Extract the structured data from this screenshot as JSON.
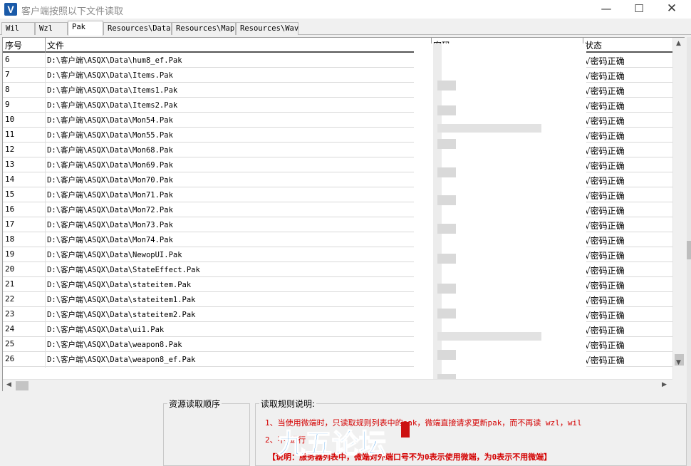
{
  "window": {
    "title": "客户端按照以下文件读取",
    "icon_letter": "V",
    "minimize_glyph": "—",
    "maximize_glyph": "☐",
    "close_glyph": "✕"
  },
  "tabs": [
    {
      "label": "Wil"
    },
    {
      "label": "Wzl"
    },
    {
      "label": "Pak",
      "active": true
    },
    {
      "label": "Resources\\Data"
    },
    {
      "label": "Resources\\Map"
    },
    {
      "label": "Resources\\Wav"
    }
  ],
  "table": {
    "columns": [
      "序号",
      "文件",
      "密码",
      "状态"
    ],
    "rows": [
      {
        "idx": "6",
        "file": "D:\\客户端\\ASQX\\Data\\hum8_ef.Pak",
        "status": "√密码正确"
      },
      {
        "idx": "7",
        "file": "D:\\客户端\\ASQX\\Data\\Items.Pak",
        "status": "√密码正确"
      },
      {
        "idx": "8",
        "file": "D:\\客户端\\ASQX\\Data\\Items1.Pak",
        "status": "√密码正确"
      },
      {
        "idx": "9",
        "file": "D:\\客户端\\ASQX\\Data\\Items2.Pak",
        "status": "√密码正确"
      },
      {
        "idx": "10",
        "file": "D:\\客户端\\ASQX\\Data\\Mon54.Pak",
        "status": "√密码正确"
      },
      {
        "idx": "11",
        "file": "D:\\客户端\\ASQX\\Data\\Mon55.Pak",
        "status": "√密码正确"
      },
      {
        "idx": "12",
        "file": "D:\\客户端\\ASQX\\Data\\Mon68.Pak",
        "status": "√密码正确"
      },
      {
        "idx": "13",
        "file": "D:\\客户端\\ASQX\\Data\\Mon69.Pak",
        "status": "√密码正确"
      },
      {
        "idx": "14",
        "file": "D:\\客户端\\ASQX\\Data\\Mon70.Pak",
        "status": "√密码正确"
      },
      {
        "idx": "15",
        "file": "D:\\客户端\\ASQX\\Data\\Mon71.Pak",
        "status": "√密码正确"
      },
      {
        "idx": "16",
        "file": "D:\\客户端\\ASQX\\Data\\Mon72.Pak",
        "status": "√密码正确"
      },
      {
        "idx": "17",
        "file": "D:\\客户端\\ASQX\\Data\\Mon73.Pak",
        "status": "√密码正确"
      },
      {
        "idx": "18",
        "file": "D:\\客户端\\ASQX\\Data\\Mon74.Pak",
        "status": "√密码正确"
      },
      {
        "idx": "19",
        "file": "D:\\客户端\\ASQX\\Data\\NewopUI.Pak",
        "status": "√密码正确"
      },
      {
        "idx": "20",
        "file": "D:\\客户端\\ASQX\\Data\\StateEffect.Pak",
        "status": "√密码正确"
      },
      {
        "idx": "21",
        "file": "D:\\客户端\\ASQX\\Data\\stateitem.Pak",
        "status": "√密码正确"
      },
      {
        "idx": "22",
        "file": "D:\\客户端\\ASQX\\Data\\stateitem1.Pak",
        "status": "√密码正确"
      },
      {
        "idx": "23",
        "file": "D:\\客户端\\ASQX\\Data\\stateitem2.Pak",
        "status": "√密码正确"
      },
      {
        "idx": "24",
        "file": "D:\\客户端\\ASQX\\Data\\ui1.Pak",
        "status": "√密码正确"
      },
      {
        "idx": "25",
        "file": "D:\\客户端\\ASQX\\Data\\weapon8.Pak",
        "status": "√密码正确"
      },
      {
        "idx": "26",
        "file": "D:\\客户端\\ASQX\\Data\\weapon8_ef.Pak",
        "status": "√密码正确"
      }
    ]
  },
  "bottom": {
    "load_order_label": "资源读取顺序",
    "rules_label": "读取规则说明:",
    "rule1": "1、当使用微端时，只读取规则列表中的pak，微端直接请求更新pak，而不再读 wzl，wil",
    "rule2": "2、不                                              进行",
    "note": "【说明：服务器列表中，微端对外端口号不为0表示使用微端，为0表示不用微端】"
  },
  "watermark": {
    "text": "九五论坛"
  },
  "colors": {
    "rule_text": "#d40000",
    "watermark": "#1e88e5",
    "app_icon": "#1a5aa8"
  }
}
